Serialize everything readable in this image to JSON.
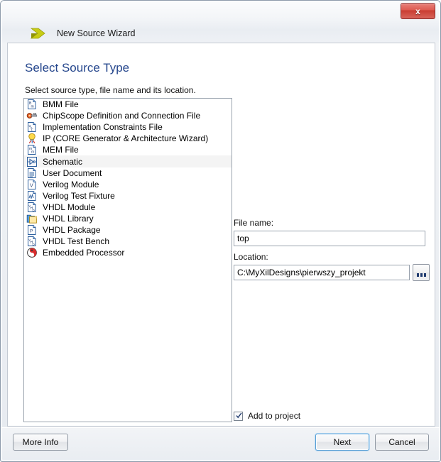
{
  "window": {
    "title": "New Source Wizard",
    "wizard_icon": "chevron-arrow-icon",
    "close_label": "x",
    "accent_color": "#26478d",
    "wizard_icon_color": "#b7bb0c",
    "close_button_color": "#c93c31"
  },
  "page": {
    "title": "Select Source Type",
    "subtitle": "Select source type, file name and its location."
  },
  "source_list": {
    "items": [
      {
        "label": "BMM File",
        "icon": "bmm-file-icon",
        "selected": false
      },
      {
        "label": "ChipScope Definition and Connection File",
        "icon": "chipscope-icon",
        "selected": false
      },
      {
        "label": "Implementation Constraints File",
        "icon": "ucf-file-icon",
        "selected": false
      },
      {
        "label": "IP (CORE Generator & Architecture Wizard)",
        "icon": "ip-core-icon",
        "selected": false
      },
      {
        "label": "MEM File",
        "icon": "mem-file-icon",
        "selected": false
      },
      {
        "label": "Schematic",
        "icon": "schematic-icon",
        "selected": true
      },
      {
        "label": "User Document",
        "icon": "user-document-icon",
        "selected": false
      },
      {
        "label": "Verilog Module",
        "icon": "verilog-module-icon",
        "selected": false
      },
      {
        "label": "Verilog Test Fixture",
        "icon": "verilog-test-fixture-icon",
        "selected": false
      },
      {
        "label": "VHDL Module",
        "icon": "vhdl-module-icon",
        "selected": false
      },
      {
        "label": "VHDL Library",
        "icon": "vhdl-library-icon",
        "selected": false
      },
      {
        "label": "VHDL Package",
        "icon": "vhdl-package-icon",
        "selected": false
      },
      {
        "label": "VHDL Test Bench",
        "icon": "vhdl-test-bench-icon",
        "selected": false
      },
      {
        "label": "Embedded Processor",
        "icon": "embedded-processor-icon",
        "selected": false
      }
    ]
  },
  "form": {
    "filename_label": "File name:",
    "filename_value": "top",
    "filename_placeholder": "",
    "location_label": "Location:",
    "location_value": "C:\\MyXilDesigns\\pierwszy_projekt",
    "location_placeholder": "",
    "browse_icon": "ellipsis-icon",
    "add_to_project_label": "Add to project",
    "add_to_project_checked": true
  },
  "footer": {
    "more_info_label": "More Info",
    "next_label": "Next",
    "cancel_label": "Cancel"
  }
}
